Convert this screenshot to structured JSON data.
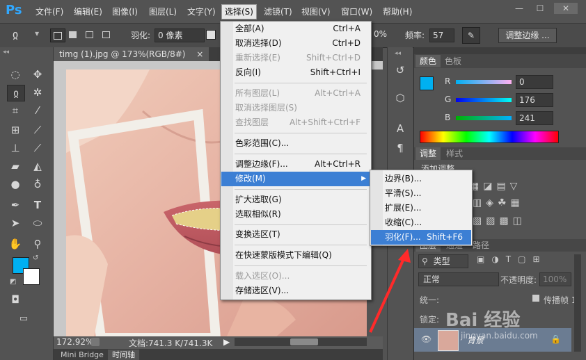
{
  "menubar": {
    "logo": "Ps",
    "items": [
      "文件(F)",
      "编辑(E)",
      "图像(I)",
      "图层(L)",
      "文字(Y)",
      "选择(S)",
      "滤镜(T)",
      "视图(V)",
      "窗口(W)",
      "帮助(H)"
    ],
    "window_buttons": [
      "—",
      "☐",
      "✕"
    ]
  },
  "options": {
    "feather_label": "羽化:",
    "feather_value": "0 像素",
    "opacity_fragment": "0%",
    "frequency_label": "频率:",
    "frequency_value": "57",
    "refine_edge_button": "调整边缘 ..."
  },
  "document": {
    "tab_title": "timg (1).jpg @ 173%(RGB/8#)",
    "tab_close": "×",
    "zoom": "172.92%",
    "doc_size": "文档:741.3 K/741.3K"
  },
  "bottom_tabs": [
    "Mini Bridge",
    "时间轴"
  ],
  "color_panel": {
    "tabs": [
      "颜色",
      "色板"
    ],
    "channels": [
      {
        "label": "R",
        "value": "0"
      },
      {
        "label": "G",
        "value": "176"
      },
      {
        "label": "B",
        "value": "241"
      }
    ],
    "foreground": "#00b0f1"
  },
  "adjust_panel": {
    "tabs": [
      "调整",
      "样式"
    ],
    "add_label": "添加调整"
  },
  "layers_panel": {
    "tabs": [
      "图层",
      "通道",
      "路径"
    ],
    "filter_kind": "类型",
    "blend_mode": "正常",
    "opacity_label": "不透明度:",
    "opacity_value": "100%",
    "unify_label": "统一:",
    "propagate_label": "传播帧 1",
    "lock_label": "锁定:",
    "layer_name": "背景"
  },
  "select_menu": {
    "items": [
      {
        "label": "全部(A)",
        "shortcut": "Ctrl+A",
        "disabled": false
      },
      {
        "label": "取消选择(D)",
        "shortcut": "Ctrl+D",
        "disabled": false
      },
      {
        "label": "重新选择(E)",
        "shortcut": "Shift+Ctrl+D",
        "disabled": true
      },
      {
        "label": "反向(I)",
        "shortcut": "Shift+Ctrl+I",
        "disabled": false
      },
      {
        "label": "所有图层(L)",
        "shortcut": "Alt+Ctrl+A",
        "disabled": true
      },
      {
        "label": "取消选择图层(S)",
        "shortcut": "",
        "disabled": true
      },
      {
        "label": "查找图层",
        "shortcut": "Alt+Shift+Ctrl+F",
        "disabled": true
      },
      {
        "label": "色彩范围(C)...",
        "shortcut": "",
        "disabled": false
      },
      {
        "label": "调整边缘(F)...",
        "shortcut": "Alt+Ctrl+R",
        "disabled": false
      },
      {
        "label": "修改(M)",
        "shortcut": "",
        "disabled": false
      },
      {
        "label": "扩大选取(G)",
        "shortcut": "",
        "disabled": false
      },
      {
        "label": "选取相似(R)",
        "shortcut": "",
        "disabled": false
      },
      {
        "label": "变换选区(T)",
        "shortcut": "",
        "disabled": false
      },
      {
        "label": "在快速蒙版模式下编辑(Q)",
        "shortcut": "",
        "disabled": false
      },
      {
        "label": "载入选区(O)...",
        "shortcut": "",
        "disabled": true
      },
      {
        "label": "存储选区(V)...",
        "shortcut": "",
        "disabled": false
      }
    ]
  },
  "modify_submenu": {
    "items": [
      {
        "label": "边界(B)...",
        "shortcut": ""
      },
      {
        "label": "平滑(S)...",
        "shortcut": ""
      },
      {
        "label": "扩展(E)...",
        "shortcut": ""
      },
      {
        "label": "收缩(C)...",
        "shortcut": ""
      },
      {
        "label": "羽化(F)...",
        "shortcut": "Shift+F6"
      }
    ]
  },
  "watermark": {
    "brand": "Bai 经验",
    "url": "jingyan.baidu.com"
  },
  "colors": {
    "accent_highlight": "#3c7fd4",
    "foreground_swatch": "#00b0f1",
    "annotation_arrow": "#ff2a2a"
  }
}
